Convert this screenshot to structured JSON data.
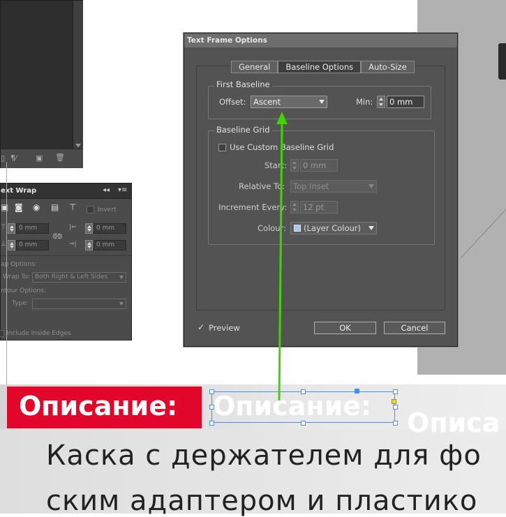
{
  "dialog": {
    "title": "Text Frame Options",
    "tabs": [
      "General",
      "Baseline Options",
      "Auto-Size"
    ],
    "active_tab": "Baseline Options",
    "first_baseline": {
      "group_title": "First Baseline",
      "offset_label": "Offset:",
      "offset_value": "Ascent",
      "min_label": "Min:",
      "min_value": "0 mm"
    },
    "baseline_grid": {
      "group_title": "Baseline Grid",
      "use_custom_label": "Use Custom Baseline Grid",
      "use_custom_checked": false,
      "start_label": "Start:",
      "start_value": "0 mm",
      "relative_to_label": "Relative To:",
      "relative_to_value": "Top Inset",
      "increment_label": "Increment Every:",
      "increment_value": "12 pt",
      "colour_label": "Colour:",
      "colour_value": "(Layer Colour)",
      "colour_swatch": "#a8c8f0"
    },
    "preview_label": "Preview",
    "preview_checked": true,
    "ok_label": "OK",
    "cancel_label": "Cancel"
  },
  "text_wrap_panel": {
    "title": "ext Wrap",
    "invert_label": "Invert",
    "top_offset": "0 mm",
    "bottom_offset": "0 mm",
    "left_offset": "0 mm",
    "right_offset": "0 mm",
    "wrap_options_label": "ap Options:",
    "wrap_to_label": "Wrap To:",
    "wrap_to_value": "Both Right & Left Sides",
    "contour_options_label": "ntour Options:",
    "type_label": "Type:",
    "include_inside_edges_label": "Include Inside Edges"
  },
  "layout_page": {
    "red_heading": "Описание:",
    "ghost_heading": "Описание:",
    "ghost_heading_partial": "Описа",
    "body_line1": "Каска с держателем для фо",
    "body_line2": "ским адаптером и пластико",
    "accent_red": "#e2062a",
    "arrow_green": "#3dd600"
  }
}
